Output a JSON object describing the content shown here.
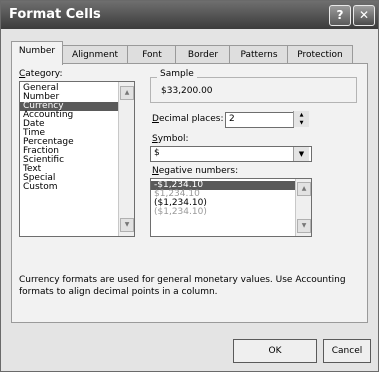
{
  "window": {
    "title": "Format Cells",
    "help_glyph": "?",
    "close_glyph": "✕"
  },
  "tabs": [
    {
      "label": "Number",
      "active": true
    },
    {
      "label": "Alignment"
    },
    {
      "label": "Font"
    },
    {
      "label": "Border"
    },
    {
      "label": "Patterns"
    },
    {
      "label": "Protection"
    }
  ],
  "category": {
    "label_ul": "C",
    "label_rest": "ategory:",
    "items": [
      "General",
      "Number",
      "Currency",
      "Accounting",
      "Date",
      "Time",
      "Percentage",
      "Fraction",
      "Scientific",
      "Text",
      "Special",
      "Custom"
    ],
    "selected": "Currency"
  },
  "sample": {
    "label": "Sample",
    "value": "$33,200.00"
  },
  "decimal_places": {
    "label_ul": "D",
    "label_rest": "ecimal places:",
    "value": "2"
  },
  "symbol": {
    "label_ul": "S",
    "label_rest": "ymbol:",
    "value": "$"
  },
  "negative_numbers": {
    "label_ul": "N",
    "label_rest": "egative numbers:",
    "items": [
      "-$1,234.10",
      "$1,234.10",
      "($1,234.10)",
      "($1,234.10)"
    ],
    "selected": "-$1,234.10",
    "gray_items": [
      1,
      3
    ]
  },
  "description": "Currency formats are used for general monetary values.  Use Accounting formats to align decimal points in a column.",
  "buttons": {
    "ok": "OK",
    "cancel": "Cancel"
  },
  "icons": {
    "up": "▲",
    "down": "▼"
  }
}
